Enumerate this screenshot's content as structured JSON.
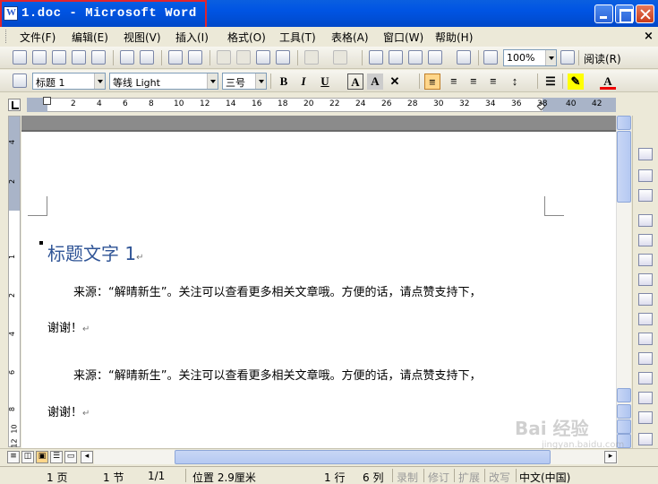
{
  "window": {
    "title": "1.doc - Microsoft Word"
  },
  "menu": {
    "items": [
      "文件(F)",
      "编辑(E)",
      "视图(V)",
      "插入(I)",
      "格式(O)",
      "工具(T)",
      "表格(A)",
      "窗口(W)",
      "帮助(H)"
    ]
  },
  "toolbar": {
    "zoom": "100%",
    "read_label": "阅读(R)"
  },
  "format": {
    "style": "标题 1",
    "font": "等线 Light",
    "size": "三号"
  },
  "ruler": {
    "ticks": [
      "2",
      "4",
      "6",
      "8",
      "10",
      "12",
      "14",
      "16",
      "18",
      "20",
      "22",
      "24",
      "26",
      "28",
      "30",
      "32",
      "34",
      "36",
      "38",
      "40",
      "42"
    ]
  },
  "left_ruler": {
    "ticks": [
      "4",
      "2",
      "1",
      "2",
      "4",
      "6",
      "8",
      "10",
      "12"
    ]
  },
  "document": {
    "heading": "标题文字 1",
    "para1_line1": "来源：“解晴新生”。关注可以查看更多相关文章哦。方便的话，请点赞支持下，",
    "para1_line2": "谢谢！",
    "para2_line1": "来源：“解晴新生”。关注可以查看更多相关文章哦。方便的话，请点赞支持下，",
    "para2_line2": "谢谢！",
    "para_mark": "↵"
  },
  "status": {
    "page": "1 页",
    "section": "1 节",
    "pages": "1/1",
    "position": "位置 2.9厘米",
    "line": "1 行",
    "col": "6 列",
    "rec": "录制",
    "trk": "修订",
    "ext": "扩展",
    "ovr": "改写",
    "lang": "中文(中国)"
  },
  "watermark": {
    "text": "Bai 经验",
    "sub": "jingyan.baidu.com"
  },
  "colors": {
    "title_bar": "#0054E3",
    "highlight_box": "#E0242E",
    "heading": "#2F5496"
  }
}
